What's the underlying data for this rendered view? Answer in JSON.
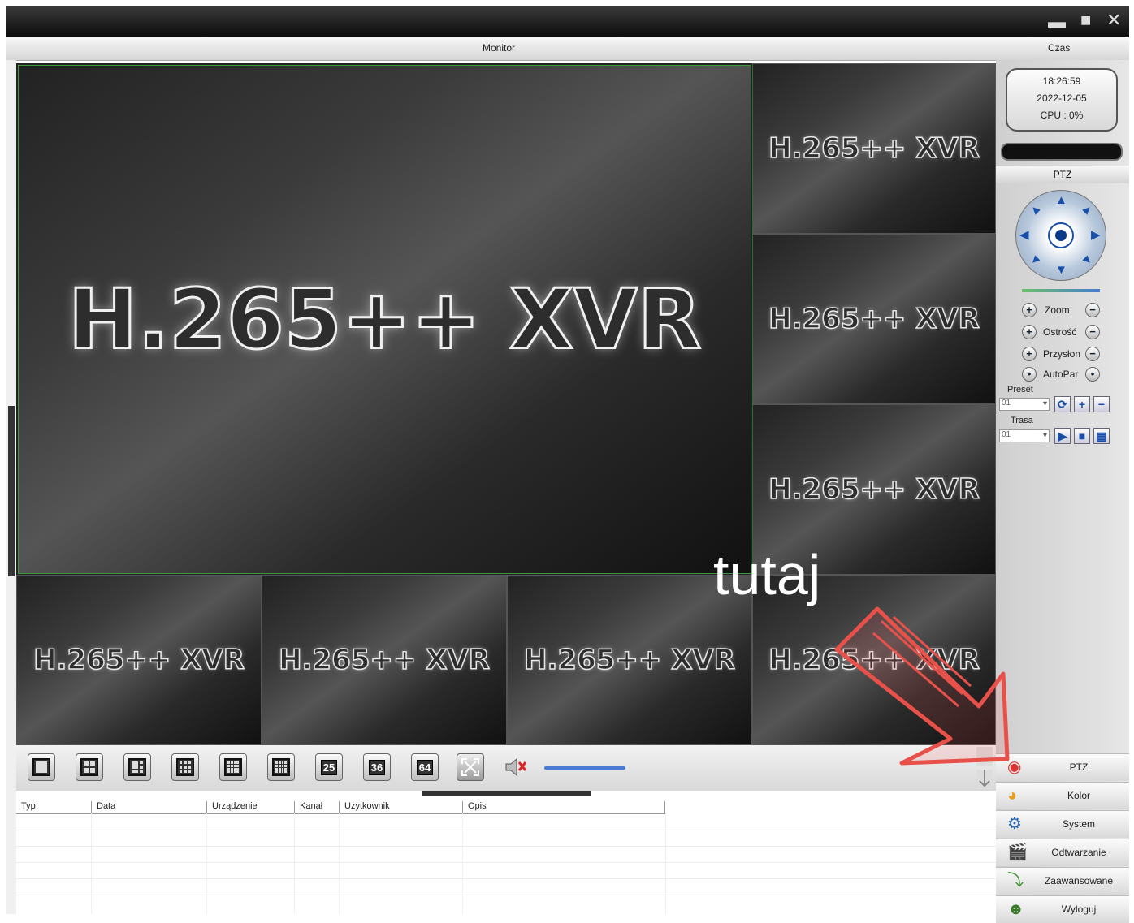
{
  "window": {
    "minimize_icon": "minimize-icon",
    "maximize_icon": "maximize-icon",
    "close_icon": "close-icon"
  },
  "header": {
    "monitor_label": "Monitor",
    "time_label": "Czas"
  },
  "channels": {
    "label": "H.265++ XVR",
    "selected_border_color": "#3a9a3a"
  },
  "toolbar": {
    "layouts": [
      "1",
      "4",
      "6",
      "8",
      "9",
      "16",
      "25",
      "36",
      "64"
    ],
    "fullscreen_icon": "fullscreen-icon",
    "mute_icon": "mute-icon"
  },
  "log": {
    "columns": [
      "Typ",
      "Data",
      "Urządzenie",
      "Kanał",
      "Użytkownik",
      "Opis"
    ]
  },
  "clock": {
    "time": "18:26:59",
    "date": "2022-12-05",
    "cpu": "CPU : 0%"
  },
  "ptz": {
    "title": "PTZ",
    "controls": [
      {
        "label": "Zoom"
      },
      {
        "label": "Ostrość"
      },
      {
        "label": "Przysłon"
      },
      {
        "label": "AutoPar"
      }
    ],
    "preset": {
      "label": "Preset",
      "value": "01"
    },
    "route": {
      "label": "Trasa",
      "value": "01"
    }
  },
  "menu": [
    {
      "label": "PTZ",
      "icon": "ptz-icon"
    },
    {
      "label": "Kolor",
      "icon": "color-icon"
    },
    {
      "label": "System",
      "icon": "system-icon"
    },
    {
      "label": "Odtwarzanie",
      "icon": "playback-icon"
    },
    {
      "label": "Zaawansowane",
      "icon": "advanced-icon"
    },
    {
      "label": "Wyloguj",
      "icon": "logout-icon"
    }
  ],
  "annotation": {
    "text": "tutaj",
    "arrow_color": "#e8504a"
  }
}
